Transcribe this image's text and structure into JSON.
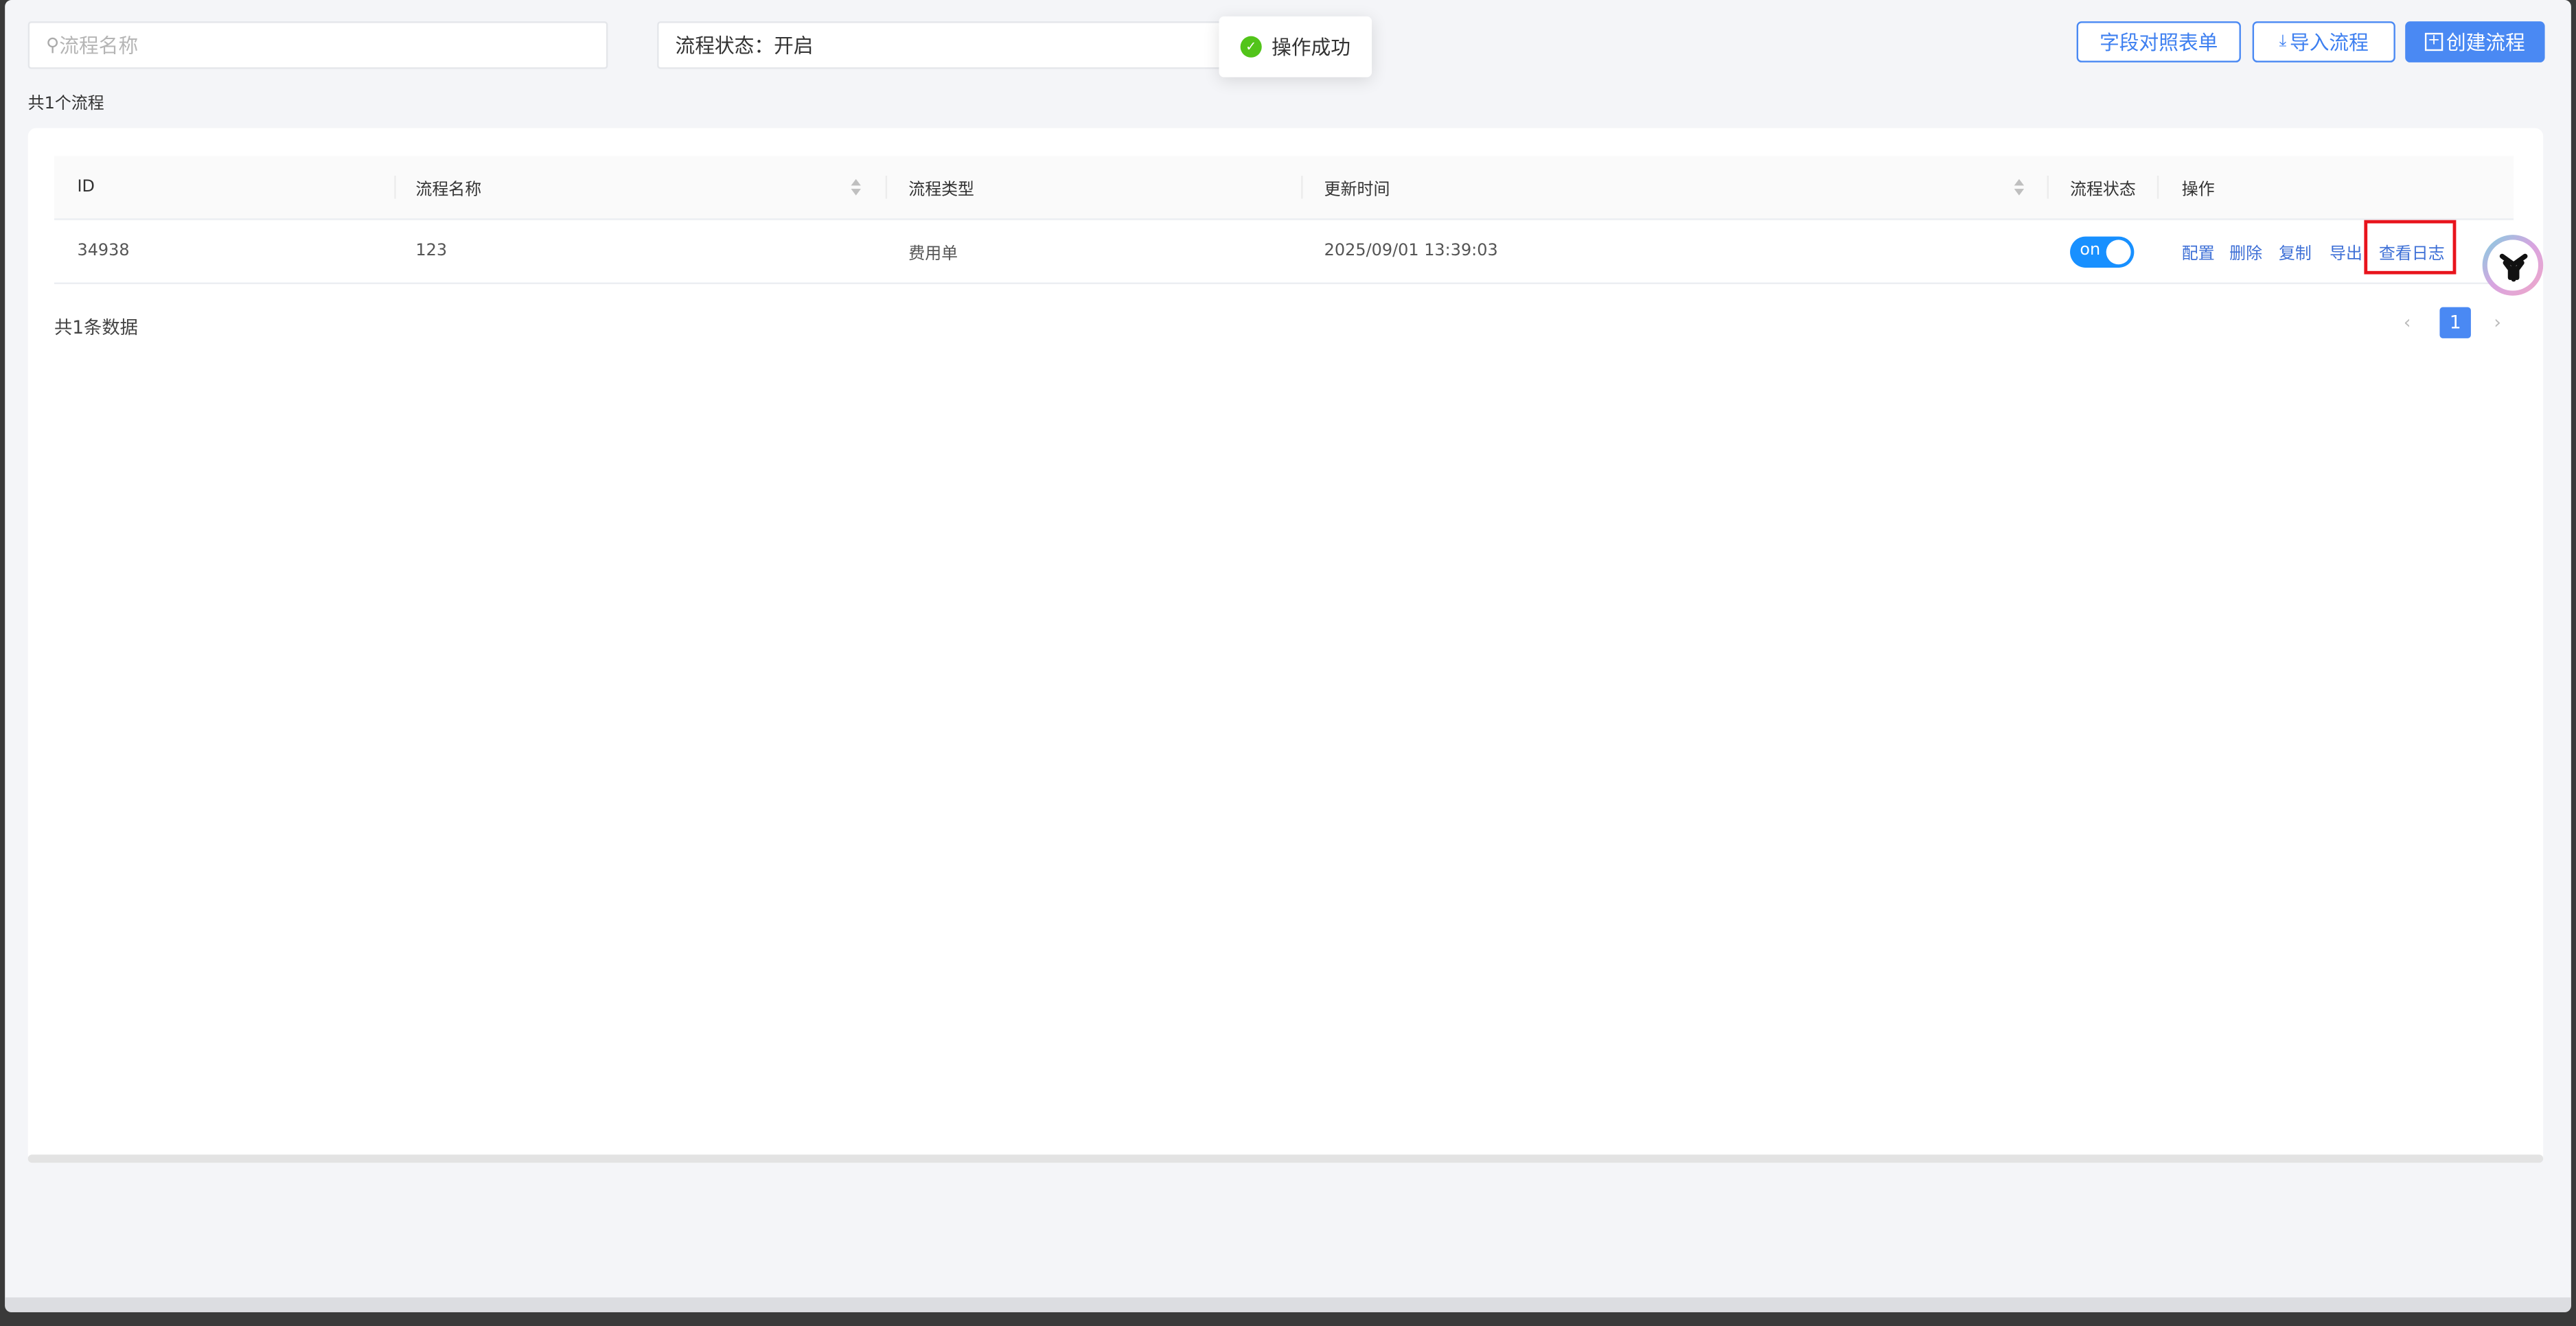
{
  "search": {
    "placeholder": "流程名称",
    "icon": "search-icon"
  },
  "status_filter": {
    "label": "流程状态：",
    "value": "开启"
  },
  "toast": {
    "message": "操作成功",
    "icon": "check-circle-icon",
    "color": "#52c41a"
  },
  "toolbar": {
    "field_mapping_label": "字段对照表单",
    "import_label": "导入流程",
    "create_label": "创建流程"
  },
  "summary": "共1个流程",
  "table": {
    "columns": [
      "ID",
      "流程名称",
      "流程类型",
      "更新时间",
      "流程状态",
      "操作"
    ],
    "rows": [
      {
        "id": "34938",
        "name": "123",
        "type": "费用单",
        "updated": "2025/09/01 13:39:03",
        "status": "on",
        "actions": [
          "配置",
          "删除",
          "复制",
          "导出",
          "查看日志"
        ]
      }
    ]
  },
  "footer": {
    "total": "共1条数据",
    "page": "1"
  },
  "colors": {
    "accent": "#4a89f3",
    "highlight": "#e8141c"
  }
}
